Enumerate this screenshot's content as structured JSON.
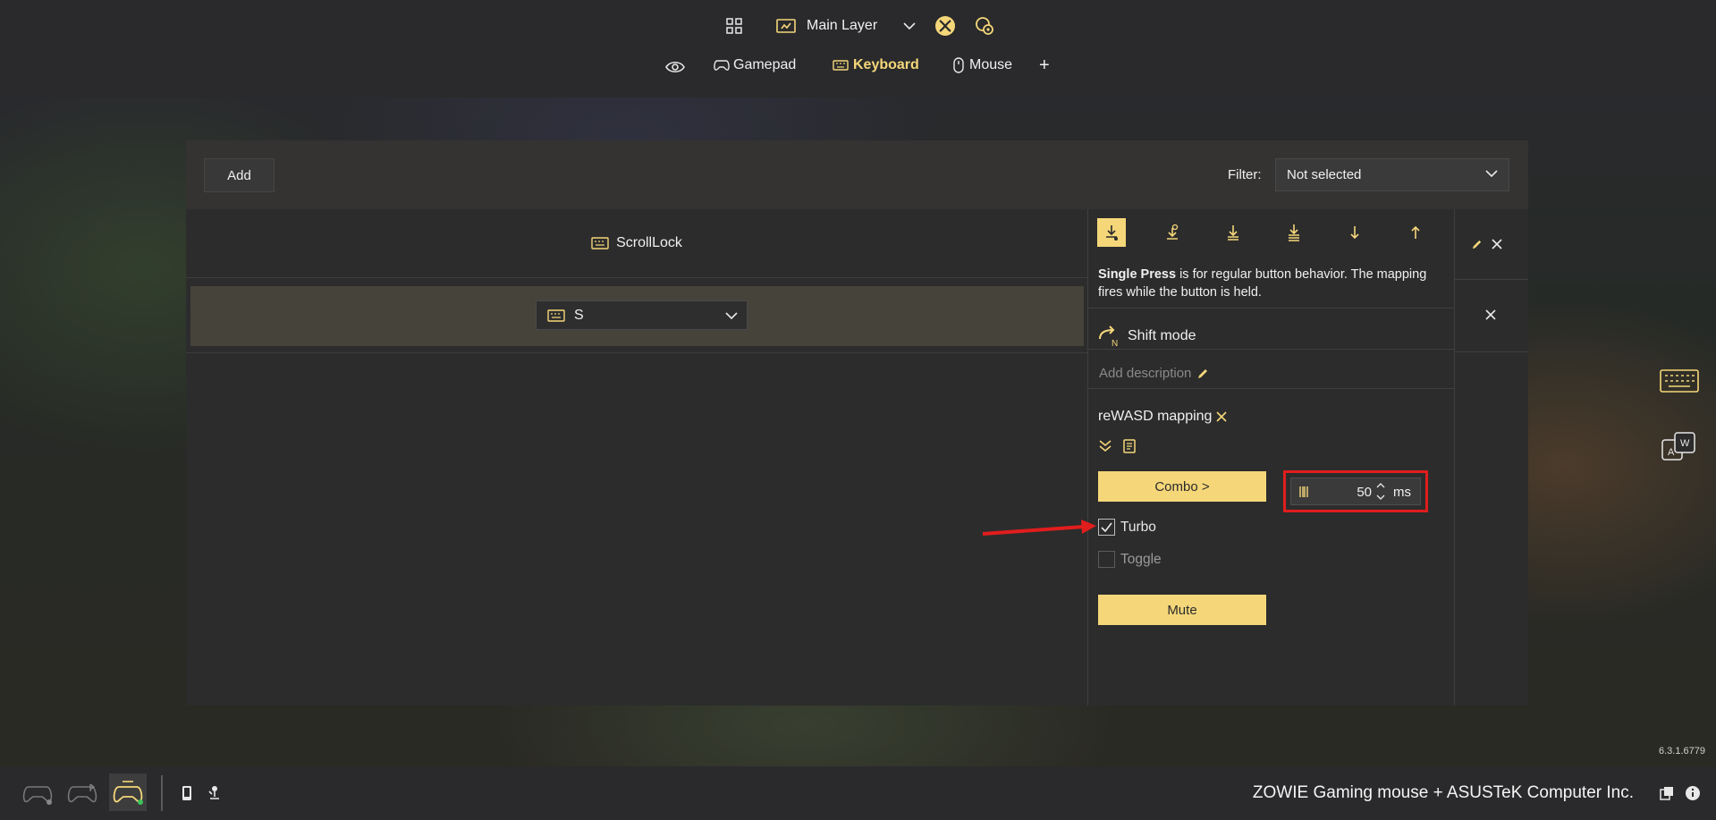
{
  "topbar": {
    "layer_label": "Main Layer",
    "tabs": [
      {
        "label": "Gamepad",
        "active": false
      },
      {
        "label": "Keyboard",
        "active": true
      },
      {
        "label": "Mouse",
        "active": false
      }
    ],
    "add_tab_glyph": "+"
  },
  "toolbar": {
    "add_label": "Add",
    "filter_label": "Filter:",
    "filter_value": "Not selected"
  },
  "mapping": {
    "source_key": "ScrollLock",
    "target_key": "S"
  },
  "editor": {
    "active_mode_index": 0,
    "description_bold": "Single Press",
    "description_rest": " is for regular button behavior. The mapping fires while the button is held.",
    "shift_mode_label": "Shift mode",
    "add_description_placeholder": "Add description",
    "mapping_label": "reWASD mapping",
    "combo_label": "Combo >",
    "turbo_label": "Turbo",
    "turbo_checked": true,
    "toggle_label": "Toggle",
    "toggle_checked": false,
    "turbo_interval_value": "50",
    "turbo_interval_unit": "ms",
    "mute_label": "Mute"
  },
  "statusbar": {
    "device_name": "ZOWIE Gaming mouse + ASUSTeK Computer Inc.",
    "version": "6.3.1.6779"
  },
  "colors": {
    "accent": "#f5d77a",
    "highlight_box": "#e11d1d",
    "background": "#2c2c2c"
  }
}
